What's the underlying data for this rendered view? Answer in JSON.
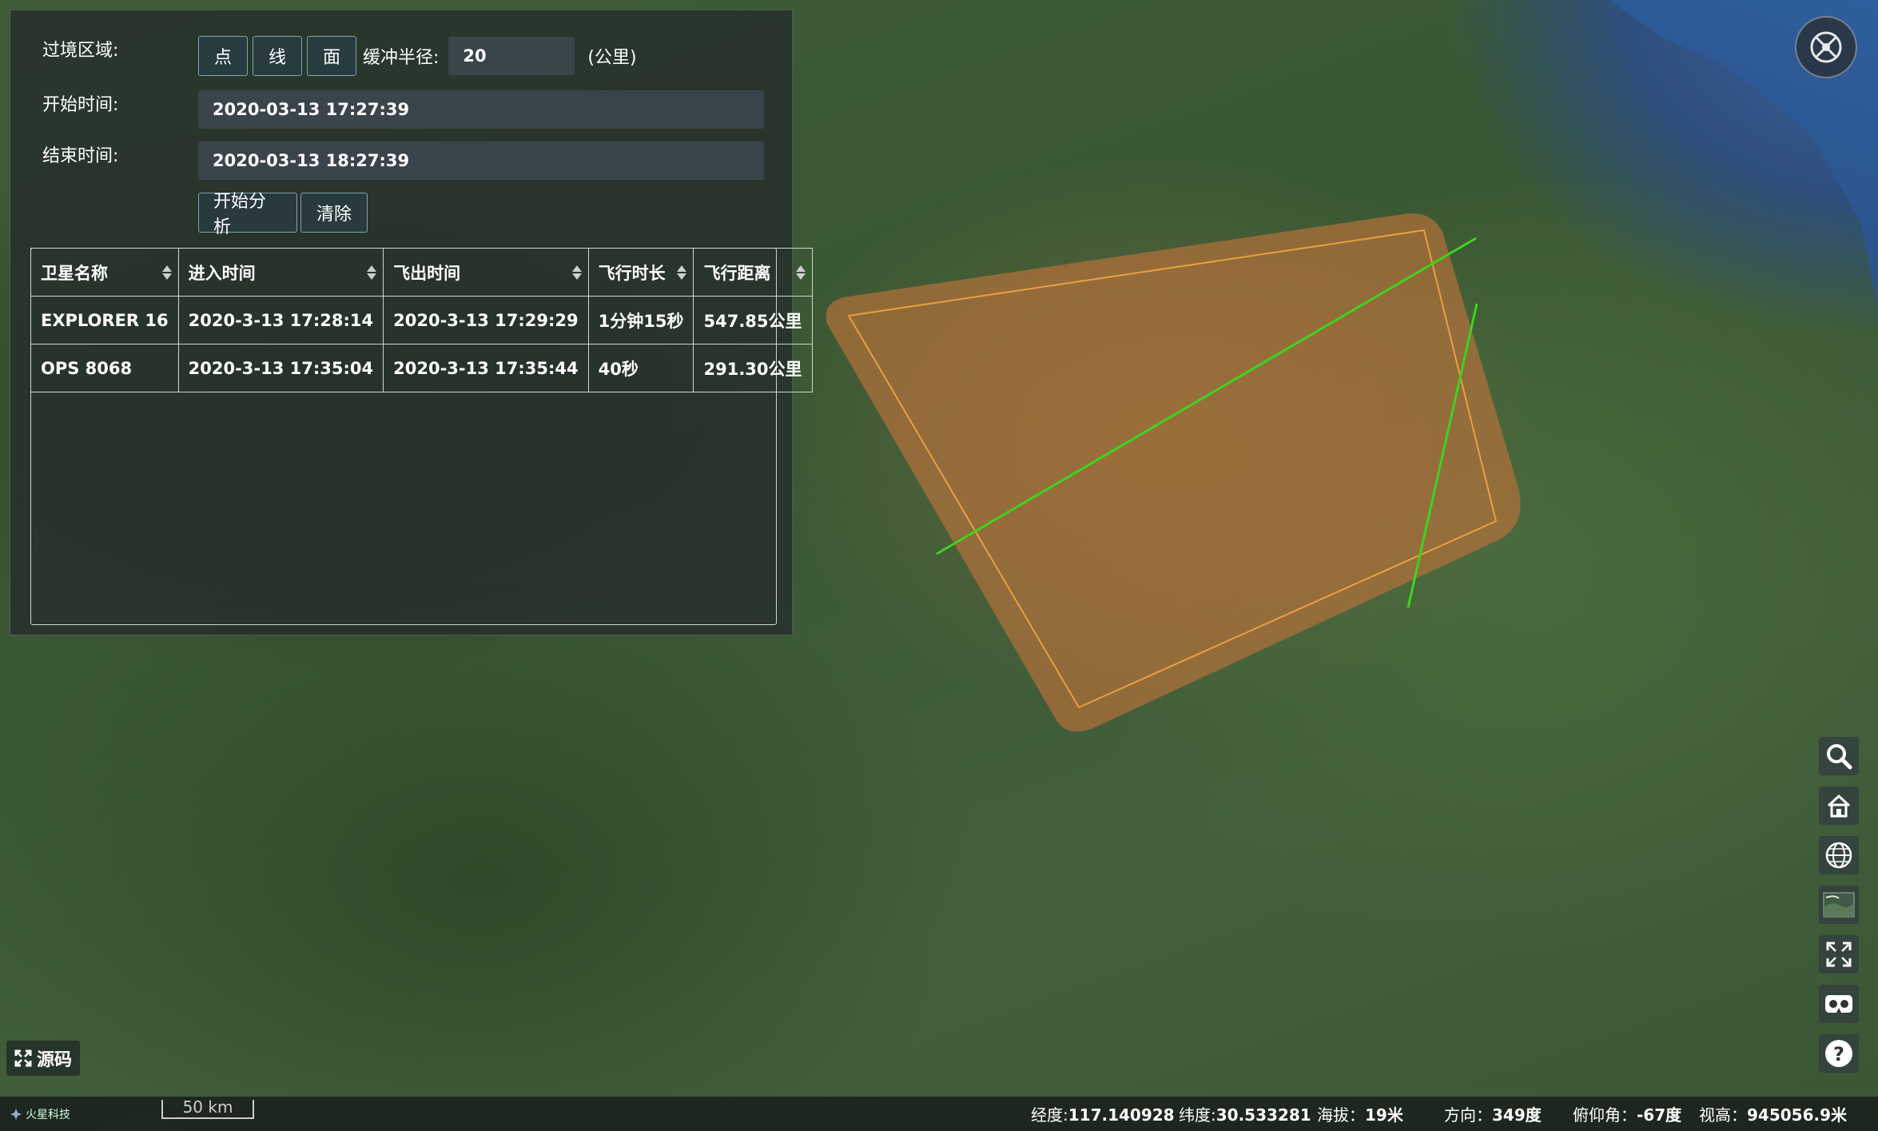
{
  "form": {
    "area_label": "过境区域:",
    "point_btn": "点",
    "line_btn": "线",
    "polygon_btn": "面",
    "radius_label": "缓冲半径:",
    "radius_value": "20",
    "radius_unit": "(公里)",
    "start_label": "开始时间:",
    "start_value": "2020-03-13 17:27:39",
    "end_label": "结束时间:",
    "end_value": "2020-03-13 18:27:39",
    "analyze_btn": "开始分析",
    "clear_btn": "清除"
  },
  "table": {
    "headers": [
      "卫星名称",
      "进入时间",
      "飞出时间",
      "飞行时长",
      "飞行距离"
    ],
    "rows": [
      [
        "EXPLORER 16",
        "2020-3-13 17:28:14",
        "2020-3-13 17:29:29",
        "1分钟15秒",
        "547.85公里"
      ],
      [
        "OPS 8068",
        "2020-3-13 17:35:04",
        "2020-3-13 17:35:44",
        "40秒",
        "291.30公里"
      ]
    ]
  },
  "source_btn": "源码",
  "toolbar_icons": [
    "search-icon",
    "home-icon",
    "globe-icon",
    "basemap-icon",
    "fullscreen-icon",
    "vr-icon",
    "help-icon"
  ],
  "status": {
    "brand": "火星科技",
    "scale": "50 km",
    "lon_label": "经度:",
    "lon": "117.140928",
    "lat_label": "纬度:",
    "lat": "30.533281",
    "alt_label": "海拔：",
    "alt": "19米",
    "heading_label": "方向：",
    "heading": "349度",
    "pitch_label": "俯仰角：",
    "pitch": "-67度",
    "height_label": "视高：",
    "height": "945056.9米"
  },
  "colors": {
    "polygon_fill": "#b5703a",
    "polygon_border": "#e8a040",
    "track_line": "#3fd21f"
  }
}
